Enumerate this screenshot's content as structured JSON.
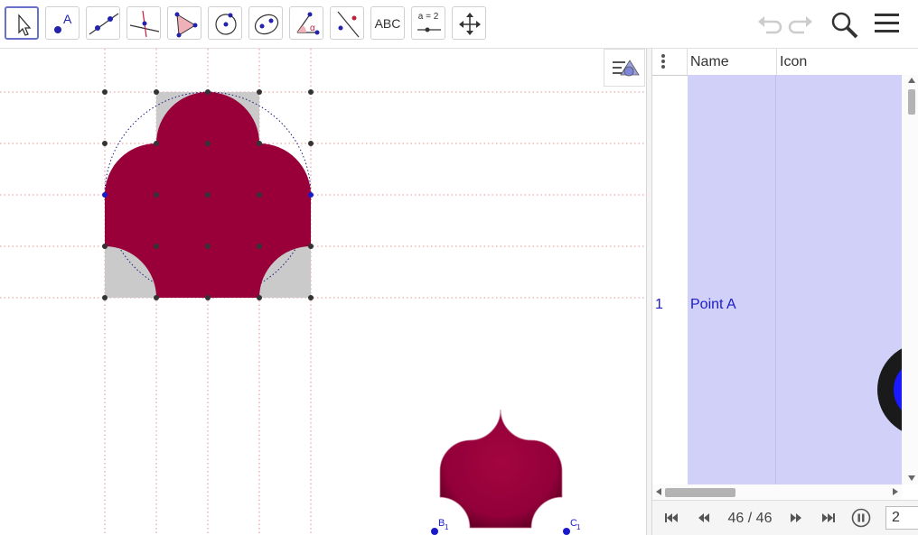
{
  "toolbar": {
    "tools": [
      {
        "name": "move-tool",
        "icon": "cursor-arrow-icon",
        "active": true
      },
      {
        "name": "point-tool",
        "icon": "point-icon",
        "label": "A"
      },
      {
        "name": "line-tool",
        "icon": "line-through-points-icon"
      },
      {
        "name": "perpendicular-line-tool",
        "icon": "perpendicular-line-icon"
      },
      {
        "name": "polygon-tool",
        "icon": "polygon-icon"
      },
      {
        "name": "circle-tool",
        "icon": "circle-center-point-icon"
      },
      {
        "name": "ellipse-tool",
        "icon": "ellipse-icon"
      },
      {
        "name": "angle-tool",
        "icon": "angle-icon",
        "label": "α"
      },
      {
        "name": "reflect-tool",
        "icon": "reflect-about-line-icon"
      },
      {
        "name": "text-tool",
        "icon": "text-icon",
        "label": "ABC"
      },
      {
        "name": "slider-tool",
        "icon": "slider-icon",
        "label": "a = 2"
      },
      {
        "name": "move-graphics-tool",
        "icon": "move-graphics-view-icon"
      }
    ],
    "right": [
      "undo-icon",
      "redo-icon",
      "search-icon",
      "menu-icon"
    ]
  },
  "graphics": {
    "labels": {
      "b1": "B",
      "b1_sub": "1",
      "c1": "C",
      "c1_sub": "1"
    },
    "colors": {
      "shape": "#99003a",
      "fill_gray": "#cacaca",
      "circle": "#1a1a80",
      "grid": "#e07070",
      "points": "#333333",
      "point_blue": "#1a1acc"
    }
  },
  "construction": {
    "menu_icon": "vertical-dots-icon",
    "columns": [
      "Name",
      "Icon"
    ],
    "rows": [
      {
        "index": "1",
        "name": "Point A"
      }
    ],
    "row_highlight": "#d0d0f8"
  },
  "playback": {
    "step": "46 / 46",
    "speed_value": "2",
    "buttons": [
      "first-step-icon",
      "previous-step-icon",
      "next-step-icon",
      "last-step-icon",
      "pause-icon"
    ]
  }
}
